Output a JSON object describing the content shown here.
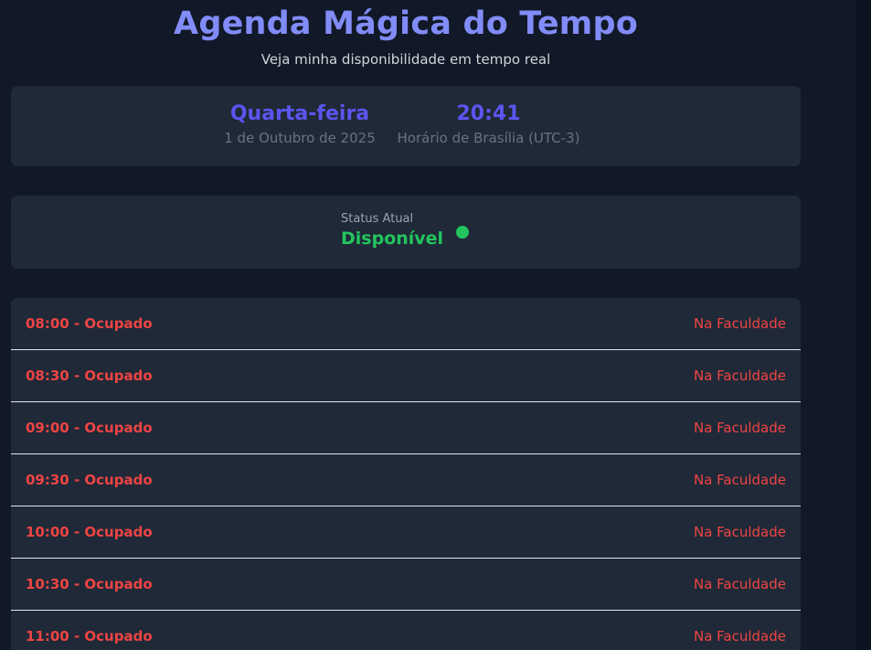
{
  "header": {
    "title": "Agenda Mágica do Tempo",
    "subtitle": "Veja minha disponibilidade em tempo real"
  },
  "clock": {
    "day_name": "Quarta-feira",
    "date": "1 de Outubro de 2025",
    "time": "20:41",
    "timezone": "Horário de Brasília (UTC-3)"
  },
  "status": {
    "label": "Status Atual",
    "value": "Disponível",
    "color": "#22c55e"
  },
  "schedule": {
    "slots": [
      {
        "time_status": "08:00 - Ocupado",
        "activity": "Na Faculdade"
      },
      {
        "time_status": "08:30 - Ocupado",
        "activity": "Na Faculdade"
      },
      {
        "time_status": "09:00 - Ocupado",
        "activity": "Na Faculdade"
      },
      {
        "time_status": "09:30 - Ocupado",
        "activity": "Na Faculdade"
      },
      {
        "time_status": "10:00 - Ocupado",
        "activity": "Na Faculdade"
      },
      {
        "time_status": "10:30 - Ocupado",
        "activity": "Na Faculdade"
      },
      {
        "time_status": "11:00 - Ocupado",
        "activity": "Na Faculdade"
      }
    ]
  },
  "colors": {
    "accent": "#818cf8",
    "busy": "#ef4444",
    "available": "#22c55e",
    "background": "#111827",
    "card": "#1f2937"
  }
}
